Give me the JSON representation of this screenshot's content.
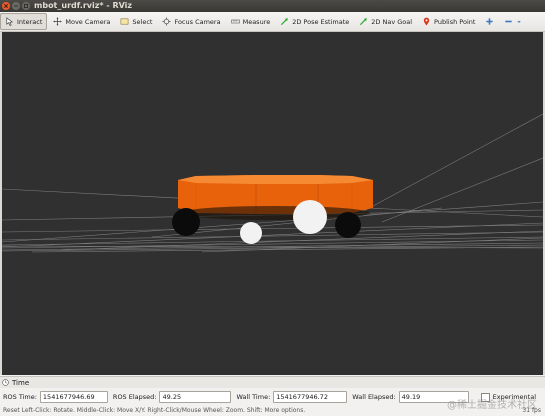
{
  "window": {
    "title": "mbot_urdf.rviz* - RViz"
  },
  "toolbar": {
    "tools": [
      {
        "label": "Interact",
        "icon": "interact-icon",
        "active": true
      },
      {
        "label": "Move Camera",
        "icon": "move-camera-icon",
        "active": false
      },
      {
        "label": "Select",
        "icon": "select-icon",
        "active": false
      },
      {
        "label": "Focus Camera",
        "icon": "focus-camera-icon",
        "active": false
      },
      {
        "label": "Measure",
        "icon": "measure-icon",
        "active": false
      },
      {
        "label": "2D Pose Estimate",
        "icon": "pose-estimate-arrow-icon",
        "active": false
      },
      {
        "label": "2D Nav Goal",
        "icon": "nav-goal-arrow-icon",
        "active": false
      },
      {
        "label": "Publish Point",
        "icon": "publish-point-pin-icon",
        "active": false
      }
    ],
    "colors": {
      "pose_arrow": "#2fa82f",
      "nav_arrow": "#2fa82f",
      "publish_pin": "#d9371e",
      "plus": "#3b78c4"
    }
  },
  "viewport": {
    "background": "#303030",
    "robot_body_color": "#f06a10",
    "wheel_color": "#0b0b0b",
    "caster_color": "#f2f2f2"
  },
  "time_panel": {
    "title": "Time",
    "ros_time_label": "ROS Time:",
    "ros_time_value": "1541677946.69",
    "ros_elapsed_label": "ROS Elapsed:",
    "ros_elapsed_value": "49.25",
    "wall_time_label": "Wall Time:",
    "wall_time_value": "1541677946.72",
    "wall_elapsed_label": "Wall Elapsed:",
    "wall_elapsed_value": "49.19",
    "experimental_label": "Experimental"
  },
  "status_bar": {
    "text": "Reset Left-Click: Rotate. Middle-Click: Move X/Y. Right-Click/Mouse Wheel: Zoom. Shift: More options.",
    "fps": "31 fps"
  },
  "watermark": "@稀土掘金技术社区"
}
